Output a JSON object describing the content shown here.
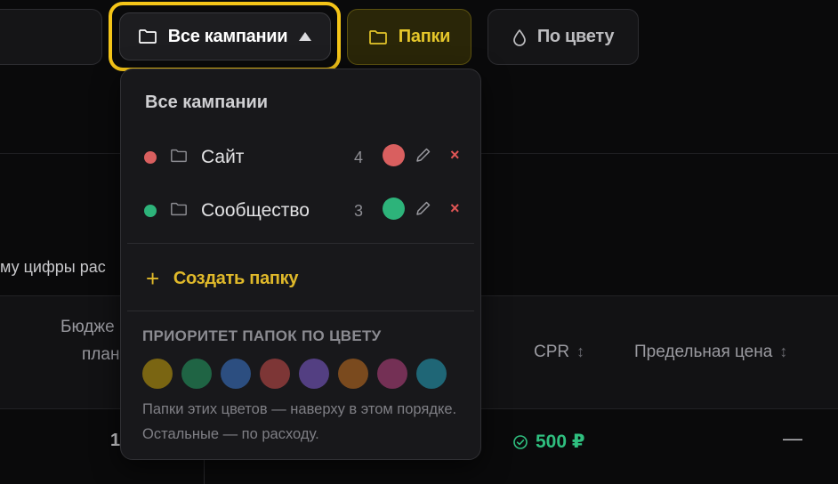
{
  "toolbar": {
    "all_campaigns_label": "Все кампании",
    "folders_label": "Папки",
    "by_color_label": "По цвету"
  },
  "background": {
    "partial_text": "му цифры рас",
    "columns": {
      "budget_line1": "Бюдже",
      "budget_line2": "план",
      "cpr": "CPR",
      "limit_price": "Предельная цена"
    },
    "row": {
      "budget_value_partial": "1",
      "cpr_value": "500 ₽",
      "limit_price_value": "—"
    }
  },
  "dropdown": {
    "title": "Все кампании",
    "folders": [
      {
        "name": "Сайт",
        "count": "4",
        "color": "#d95f5f",
        "delete": "×"
      },
      {
        "name": "Сообщество",
        "count": "3",
        "color": "#2db37a",
        "delete": "×"
      }
    ],
    "create_label": "Создать папку",
    "create_icon": "+",
    "priority_title": "ПРИОРИТЕТ ПАПОК ПО ЦВЕТУ",
    "palette": [
      "#7a6512",
      "#1f6444",
      "#2c4e80",
      "#7d3636",
      "#533f82",
      "#7a4a1e",
      "#743055",
      "#1f6676"
    ],
    "hint": "Папки этих цветов — наверху в этом порядке. Остальные — по расходу."
  },
  "colors": {
    "accent": "#f5c518",
    "success": "#2fbf7f",
    "danger": "#e05555"
  }
}
